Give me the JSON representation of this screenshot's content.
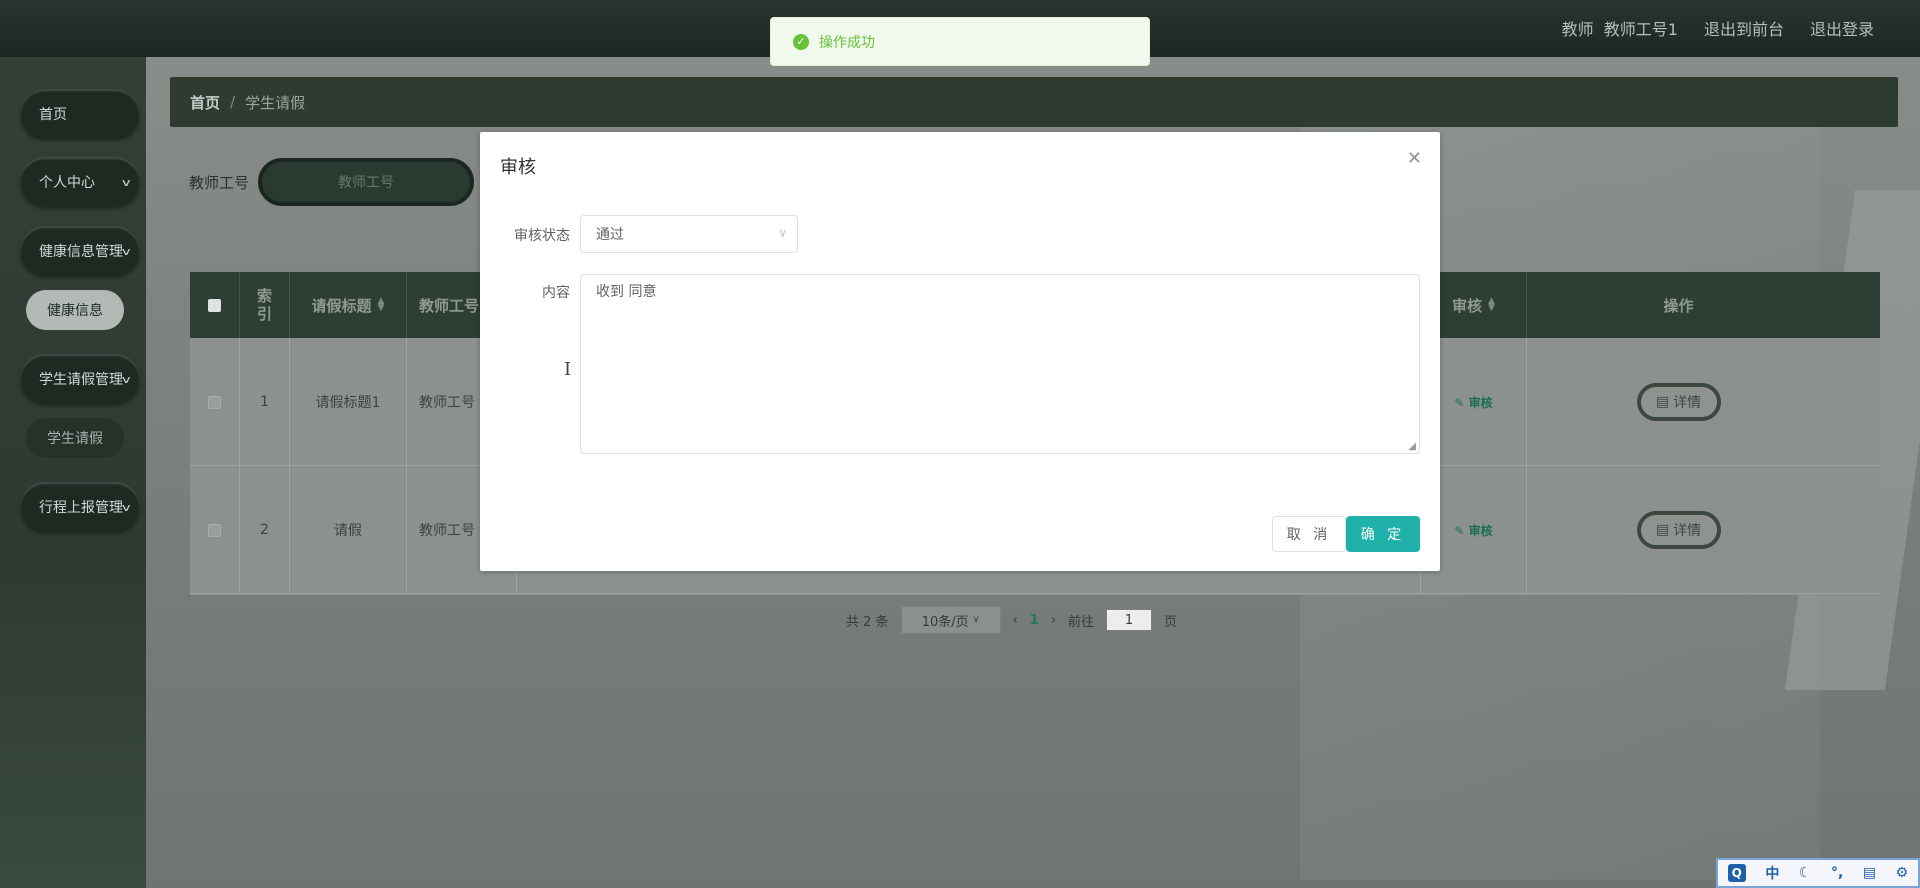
{
  "topbar": {
    "user_role": "教师",
    "user_name": "教师工号1",
    "front_link": "退出到前台",
    "logout_link": "退出登录"
  },
  "sidebar": {
    "items": [
      {
        "label": "首页",
        "has_arrow": false
      },
      {
        "label": "个人中心",
        "has_arrow": true
      },
      {
        "label": "健康信息管理",
        "has_arrow": true
      },
      {
        "label": "健康信息",
        "is_sub": true
      },
      {
        "label": "学生请假管理",
        "has_arrow": true
      },
      {
        "label": "学生请假",
        "is_sub": true
      },
      {
        "label": "行程上报管理",
        "has_arrow": true
      }
    ],
    "arrow_icon": "chevron-down-icon"
  },
  "breadcrumb": {
    "home": "首页",
    "current": "学生请假"
  },
  "search": {
    "label": "教师工号",
    "placeholder": "教师工号"
  },
  "table": {
    "headers": {
      "index": "索引",
      "title": "请假标题",
      "teacher": "教师工号",
      "audit": "审核",
      "actions": "操作"
    },
    "rows": [
      {
        "index": "1",
        "title": "请假标题1",
        "teacher": "教师工号",
        "audit": "审核",
        "detail": "详情"
      },
      {
        "index": "2",
        "title": "请假",
        "teacher": "教师工号",
        "audit": "审核",
        "detail": "详情"
      }
    ]
  },
  "pager": {
    "total_text": "共 2 条",
    "page_size": "10条/页",
    "current_page": "1",
    "goto_label": "前往",
    "goto_value": "1",
    "page_unit": "页"
  },
  "toast": {
    "message": "操作成功",
    "color": "#67c23a"
  },
  "dialog": {
    "title": "审核",
    "status_label": "审核状态",
    "status_value": "通过",
    "content_label": "内容",
    "content_value": "收到 同意",
    "cancel_label": "取 消",
    "confirm_label": "确 定",
    "confirm_color": "#20b2aa"
  },
  "ime": {
    "items": [
      "中",
      "☾",
      "°,",
      "▤",
      "⚙"
    ]
  }
}
